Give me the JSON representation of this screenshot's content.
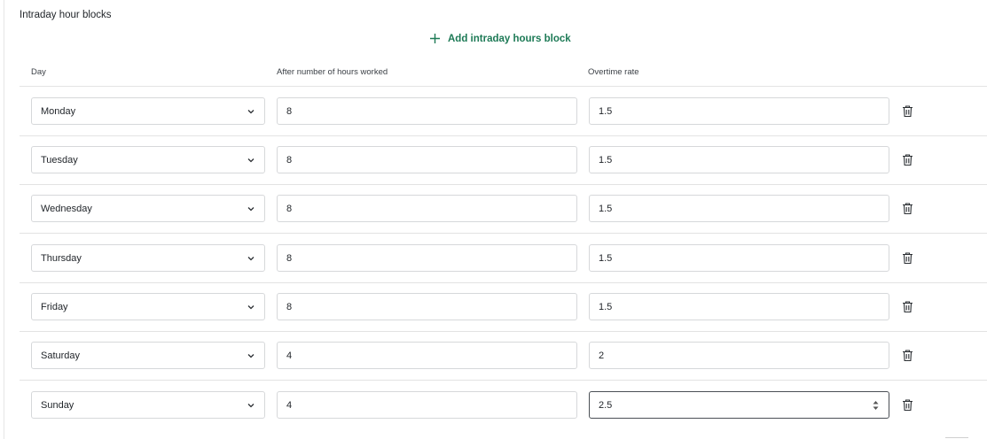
{
  "section": {
    "title": "Intraday hour blocks",
    "add_label": "Add intraday hours block"
  },
  "columns": {
    "day": "Day",
    "hours": "After number of hours worked",
    "rate": "Overtime rate"
  },
  "rows": [
    {
      "day": "Monday",
      "hours": "8",
      "rate": "1.5"
    },
    {
      "day": "Tuesday",
      "hours": "8",
      "rate": "1.5"
    },
    {
      "day": "Wednesday",
      "hours": "8",
      "rate": "1.5"
    },
    {
      "day": "Thursday",
      "hours": "8",
      "rate": "1.5"
    },
    {
      "day": "Friday",
      "hours": "8",
      "rate": "1.5"
    },
    {
      "day": "Saturday",
      "hours": "4",
      "rate": "2"
    },
    {
      "day": "Sunday",
      "hours": "4",
      "rate": "2.5"
    }
  ],
  "focused_field": "rows.6.rate",
  "colors": {
    "accent": "#1d7a56",
    "border": "#d6d8da",
    "divider": "#e3e3e3",
    "focus_border": "#4a4f55"
  },
  "icons": {
    "add": "plus-icon",
    "select": "chevron-down-icon",
    "delete": "trash-icon",
    "number": "spinner-icon"
  }
}
